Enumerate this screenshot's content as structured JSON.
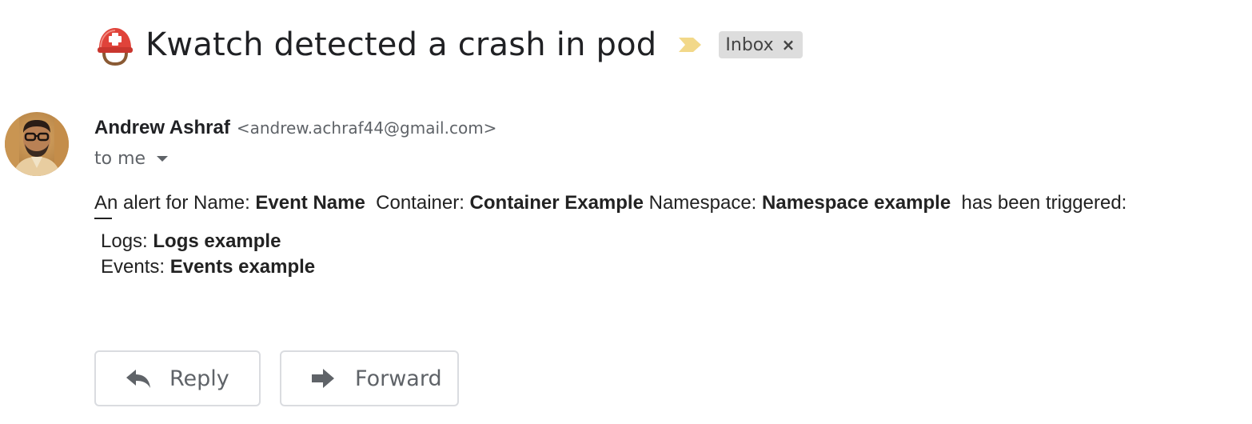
{
  "message": {
    "subject": "Kwatch detected a crash in pod",
    "subject_icon": "rescue-worker-helmet-icon",
    "label_chip": {
      "label": "Inbox",
      "close": "×"
    },
    "sender": {
      "name": "Andrew Ashraf",
      "email": "<andrew.achraf44@gmail.com>"
    },
    "recipient_label": "to me",
    "body": {
      "intro": "An alert for Name: ",
      "name_value": "Event Name",
      "container_label": "  Container: ",
      "container_value": "Container Example",
      "namespace_label": " Namespace: ",
      "namespace_value": "Namespace example",
      "suffix": "  has been triggered:",
      "logs_label": "Logs: ",
      "logs_value": "Logs example",
      "events_label": "Events: ",
      "events_value": "Events example"
    }
  },
  "actions": {
    "reply_label": "Reply",
    "forward_label": "Forward"
  },
  "colors": {
    "importance_marker": "#f2d889",
    "chip_background": "#dddddd",
    "helmet_red": "#d93025"
  }
}
